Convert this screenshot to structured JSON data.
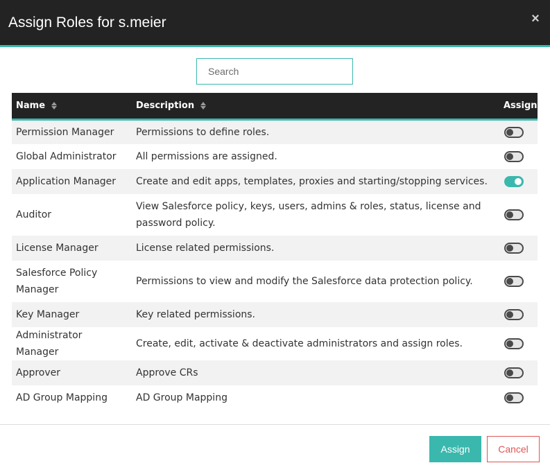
{
  "dialog": {
    "title": "Assign Roles for s.meier",
    "close_label": "×"
  },
  "search": {
    "placeholder": "Search",
    "value": ""
  },
  "table": {
    "columns": {
      "name": "Name",
      "description": "Description",
      "assign": "Assign"
    },
    "rows": [
      {
        "name": "Permission Manager",
        "description": "Permissions to define roles.",
        "assigned": false
      },
      {
        "name": "Global Administrator",
        "description": "All permissions are assigned.",
        "assigned": false
      },
      {
        "name": "Application Manager",
        "description": "Create and edit apps, templates, proxies and starting/stopping services.",
        "assigned": true
      },
      {
        "name": "Auditor",
        "description": "View Salesforce policy, keys, users, admins & roles, status, license and password policy.",
        "assigned": false
      },
      {
        "name": "License Manager",
        "description": "License related permissions.",
        "assigned": false
      },
      {
        "name": "Salesforce Policy Manager",
        "description": "Permissions to view and modify the Salesforce data protection policy.",
        "assigned": false
      },
      {
        "name": "Key Manager",
        "description": "Key related permissions.",
        "assigned": false
      },
      {
        "name": "Administrator Manager",
        "description": "Create, edit, activate & deactivate administrators and assign roles.",
        "assigned": false
      },
      {
        "name": "Approver",
        "description": "Approve CRs",
        "assigned": false
      },
      {
        "name": "AD Group Mapping",
        "description": "AD Group Mapping",
        "assigned": false
      }
    ]
  },
  "footer": {
    "assign_label": "Assign",
    "cancel_label": "Cancel"
  },
  "colors": {
    "accent": "#3bb8ad",
    "header_bg": "#232323",
    "danger": "#e05555"
  }
}
